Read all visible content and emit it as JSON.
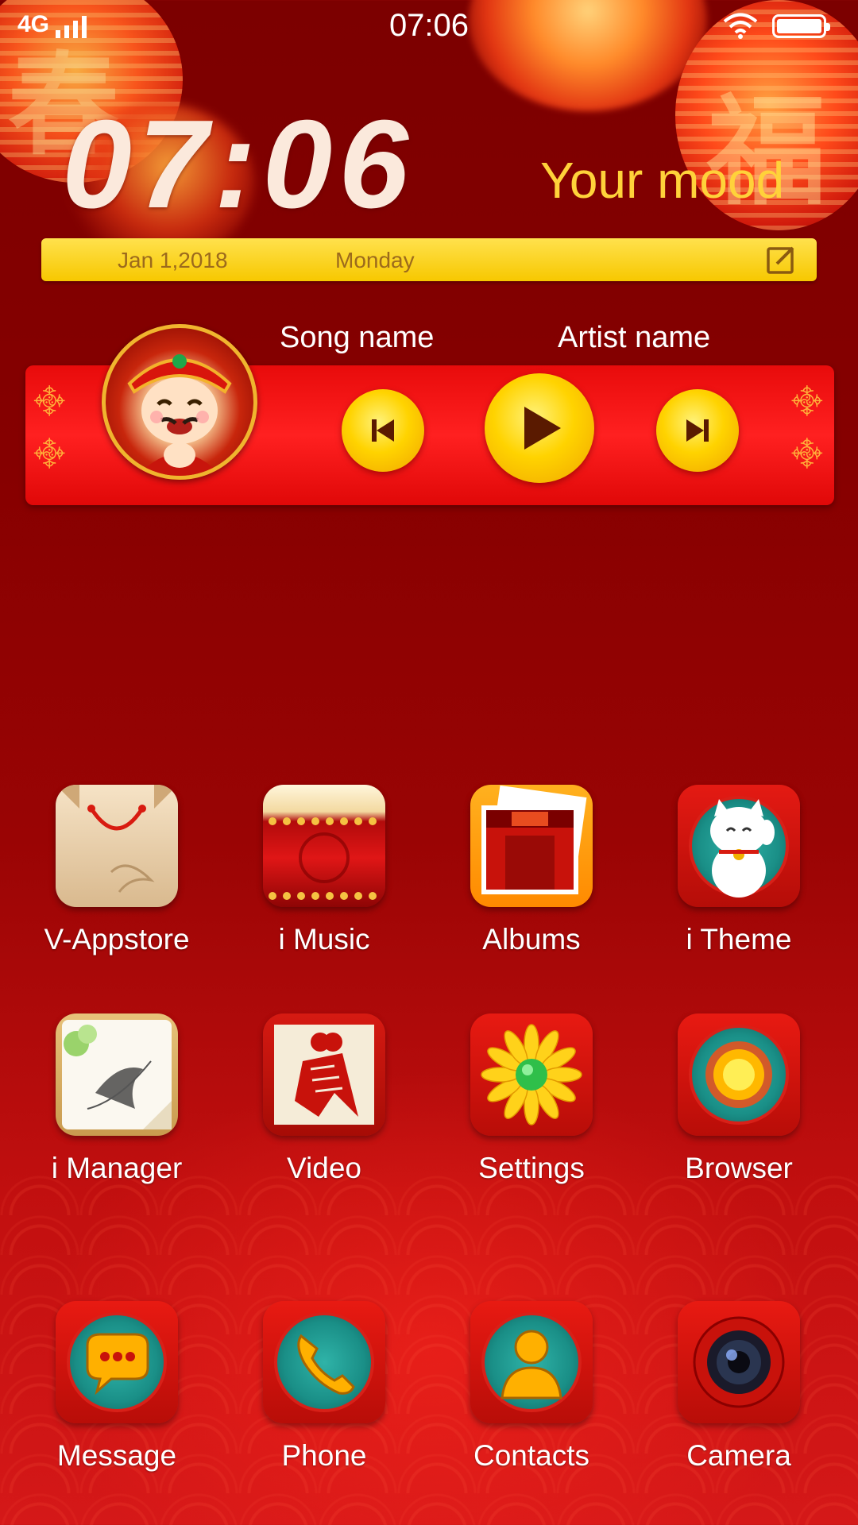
{
  "status_bar": {
    "network": "4G",
    "time": "07:06"
  },
  "widget": {
    "clock": "07:06",
    "mood": "Your mood",
    "date": "Jan 1,2018",
    "weekday": "Monday"
  },
  "music": {
    "song": "Song name",
    "artist": "Artist name"
  },
  "apps": [
    {
      "label": "V-Appstore",
      "icon": "shopping-bag-icon"
    },
    {
      "label": "i Music",
      "icon": "drum-icon"
    },
    {
      "label": "Albums",
      "icon": "photo-album-icon"
    },
    {
      "label": "i Theme",
      "icon": "lucky-cat-icon"
    },
    {
      "label": "i Manager",
      "icon": "ink-painting-icon"
    },
    {
      "label": "Video",
      "icon": "paper-cut-icon"
    },
    {
      "label": "Settings",
      "icon": "chrysanthemum-icon"
    },
    {
      "label": "Browser",
      "icon": "sun-globe-icon"
    }
  ],
  "dock": [
    {
      "label": "Message",
      "icon": "chat-bubble-icon"
    },
    {
      "label": "Phone",
      "icon": "phone-icon"
    },
    {
      "label": "Contacts",
      "icon": "person-icon"
    },
    {
      "label": "Camera",
      "icon": "camera-lens-icon"
    }
  ],
  "colors": {
    "background": "#8a0000",
    "accent_yellow": "#ffd23a",
    "player_red": "#ff2020",
    "icon_teal": "#1a8f87"
  }
}
